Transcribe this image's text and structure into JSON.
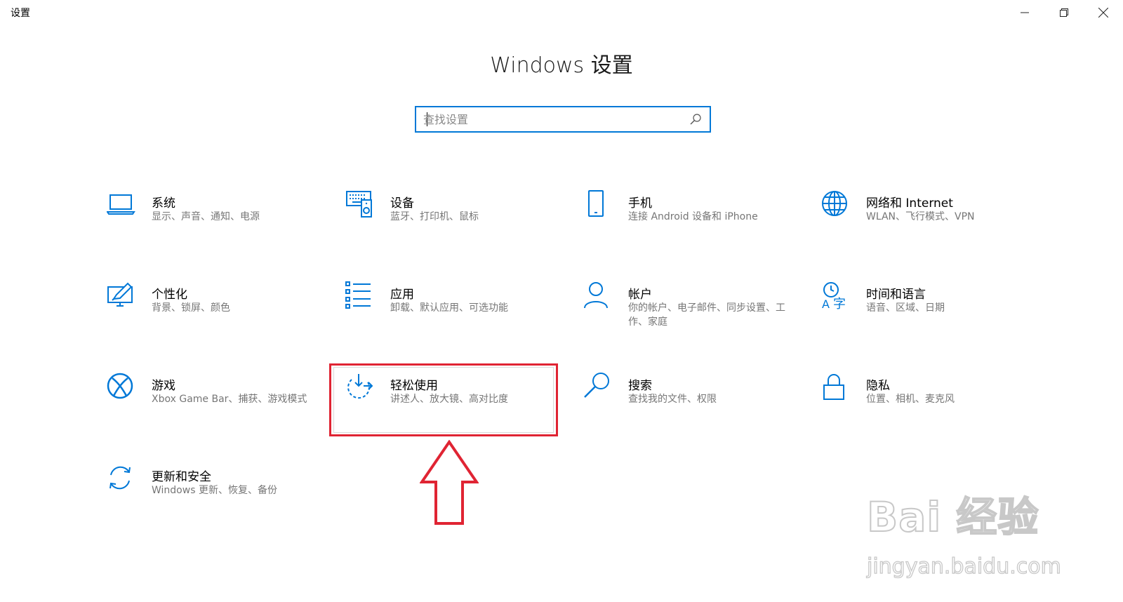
{
  "window": {
    "title": "设置"
  },
  "header": {
    "title": "Windows 设置"
  },
  "search": {
    "placeholder": "查找设置",
    "value": ""
  },
  "tiles": [
    {
      "name": "系统",
      "desc": "显示、声音、通知、电源",
      "icon": "laptop-icon"
    },
    {
      "name": "设备",
      "desc": "蓝牙、打印机、鼠标",
      "icon": "devices-icon"
    },
    {
      "name": "手机",
      "desc": "连接 Android 设备和 iPhone",
      "icon": "phone-icon"
    },
    {
      "name": "网络和 Internet",
      "desc": "WLAN、飞行模式、VPN",
      "icon": "globe-icon"
    },
    {
      "name": "个性化",
      "desc": "背景、锁屏、颜色",
      "icon": "paint-icon"
    },
    {
      "name": "应用",
      "desc": "卸载、默认应用、可选功能",
      "icon": "apps-list-icon"
    },
    {
      "name": "帐户",
      "desc": "你的帐户、电子邮件、同步设置、工作、家庭",
      "icon": "person-icon"
    },
    {
      "name": "时间和语言",
      "desc": "语音、区域、日期",
      "icon": "time-language-icon"
    },
    {
      "name": "游戏",
      "desc": "Xbox Game Bar、捕获、游戏模式",
      "icon": "xbox-icon"
    },
    {
      "name": "轻松使用",
      "desc": "讲述人、放大镜、高对比度",
      "icon": "ease-of-access-icon"
    },
    {
      "name": "搜索",
      "desc": "查找我的文件、权限",
      "icon": "magnifier-icon"
    },
    {
      "name": "隐私",
      "desc": "位置、相机、麦克风",
      "icon": "lock-icon"
    },
    {
      "name": "更新和安全",
      "desc": "Windows 更新、恢复、备份",
      "icon": "sync-icon"
    }
  ],
  "watermark": {
    "brand": "Bai 经验",
    "url": "jingyan.baidu.com"
  },
  "colors": {
    "accent": "#0078d7",
    "highlight": "#e02433",
    "desc_text": "#767676"
  }
}
